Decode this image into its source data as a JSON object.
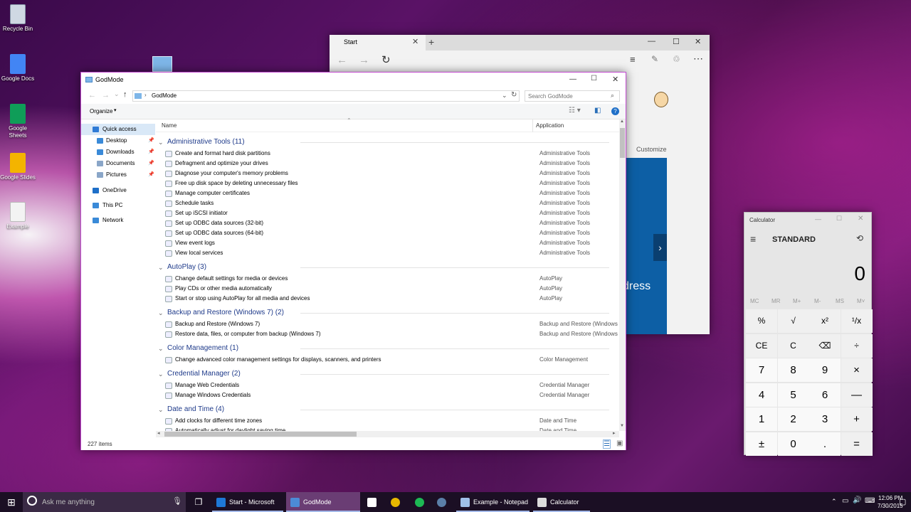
{
  "desktop": {
    "icons": [
      {
        "label": "Recycle Bin",
        "color": "#cfd8e3"
      },
      {
        "label": "Google Docs",
        "color": "#4285f4"
      },
      {
        "label": "Google Sheets",
        "color": "#0f9d58"
      },
      {
        "label": "Google Slides",
        "color": "#f4b400"
      },
      {
        "label": "Example",
        "color": "#f3f3f3"
      }
    ]
  },
  "explorer": {
    "title": "GodMode",
    "path": "GodMode",
    "search_placeholder": "Search GodMode",
    "organize": "Organize",
    "col_name": "Name",
    "col_app": "Application",
    "status": "227 items",
    "sidebar": [
      {
        "label": "Quick access",
        "icon": "star-icon",
        "color": "#2f7bd6"
      },
      {
        "label": "Desktop",
        "icon": "desktop-icon",
        "color": "#3a8ad8"
      },
      {
        "label": "Downloads",
        "icon": "downloads-icon",
        "color": "#3a8ad8"
      },
      {
        "label": "Documents",
        "icon": "documents-icon",
        "color": "#8aa6c8"
      },
      {
        "label": "Pictures",
        "icon": "pictures-icon",
        "color": "#8aa6c8"
      },
      {
        "label": "OneDrive",
        "icon": "onedrive-icon",
        "color": "#1e6fc8"
      },
      {
        "label": "This PC",
        "icon": "pc-icon",
        "color": "#3a8ad8"
      },
      {
        "label": "Network",
        "icon": "network-icon",
        "color": "#3a8ad8"
      }
    ],
    "groups": [
      {
        "title": "Administrative Tools (11)",
        "items": [
          {
            "name": "Create and format hard disk partitions",
            "app": "Administrative Tools"
          },
          {
            "name": "Defragment and optimize your drives",
            "app": "Administrative Tools"
          },
          {
            "name": "Diagnose your computer's memory problems",
            "app": "Administrative Tools"
          },
          {
            "name": "Free up disk space by deleting unnecessary files",
            "app": "Administrative Tools"
          },
          {
            "name": "Manage computer certificates",
            "app": "Administrative Tools"
          },
          {
            "name": "Schedule tasks",
            "app": "Administrative Tools"
          },
          {
            "name": "Set up iSCSI initiator",
            "app": "Administrative Tools"
          },
          {
            "name": "Set up ODBC data sources (32-bit)",
            "app": "Administrative Tools"
          },
          {
            "name": "Set up ODBC data sources (64-bit)",
            "app": "Administrative Tools"
          },
          {
            "name": "View event logs",
            "app": "Administrative Tools"
          },
          {
            "name": "View local services",
            "app": "Administrative Tools"
          }
        ]
      },
      {
        "title": "AutoPlay (3)",
        "items": [
          {
            "name": "Change default settings for media or devices",
            "app": "AutoPlay"
          },
          {
            "name": "Play CDs or other media automatically",
            "app": "AutoPlay"
          },
          {
            "name": "Start or stop using AutoPlay for all media and devices",
            "app": "AutoPlay"
          }
        ]
      },
      {
        "title": "Backup and Restore (Windows 7) (2)",
        "items": [
          {
            "name": "Backup and Restore (Windows 7)",
            "app": "Backup and Restore (Windows 7)"
          },
          {
            "name": "Restore data, files, or computer from backup (Windows 7)",
            "app": "Backup and Restore (Windows 7)"
          }
        ]
      },
      {
        "title": "Color Management (1)",
        "items": [
          {
            "name": "Change advanced color management settings for displays, scanners, and printers",
            "app": "Color Management"
          }
        ]
      },
      {
        "title": "Credential Manager (2)",
        "items": [
          {
            "name": "Manage Web Credentials",
            "app": "Credential Manager"
          },
          {
            "name": "Manage Windows Credentials",
            "app": "Credential Manager"
          }
        ]
      },
      {
        "title": "Date and Time (4)",
        "items": [
          {
            "name": "Add clocks for different time zones",
            "app": "Date and Time"
          },
          {
            "name": "Automatically adjust for daylight saving time",
            "app": "Date and Time"
          }
        ]
      }
    ]
  },
  "edge": {
    "tab_title": "Start",
    "customize": "Customize",
    "hero_text": "dress"
  },
  "calculator": {
    "title": "Calculator",
    "mode": "STANDARD",
    "display": "0",
    "memory": [
      "MC",
      "MR",
      "M+",
      "M-",
      "MS",
      "M˅"
    ],
    "keys": [
      [
        "%",
        "√",
        "x²",
        "¹/x"
      ],
      [
        "CE",
        "C",
        "⌫",
        "÷"
      ],
      [
        "7",
        "8",
        "9",
        "×"
      ],
      [
        "4",
        "5",
        "6",
        "—"
      ],
      [
        "1",
        "2",
        "3",
        "+"
      ],
      [
        "±",
        "0",
        ".",
        "="
      ]
    ]
  },
  "taskbar": {
    "search": "Ask me anything",
    "items": [
      {
        "label": "Start - Microsoft Ed...",
        "color": "#1e78d7"
      },
      {
        "label": "GodMode",
        "color": "#4c8bd6"
      },
      {
        "label": "Example - Notepad",
        "color": "#9fc0e8"
      },
      {
        "label": "Calculator",
        "color": "#dcdcdc"
      }
    ],
    "time": "12:06 PM",
    "date": "7/30/2015"
  }
}
